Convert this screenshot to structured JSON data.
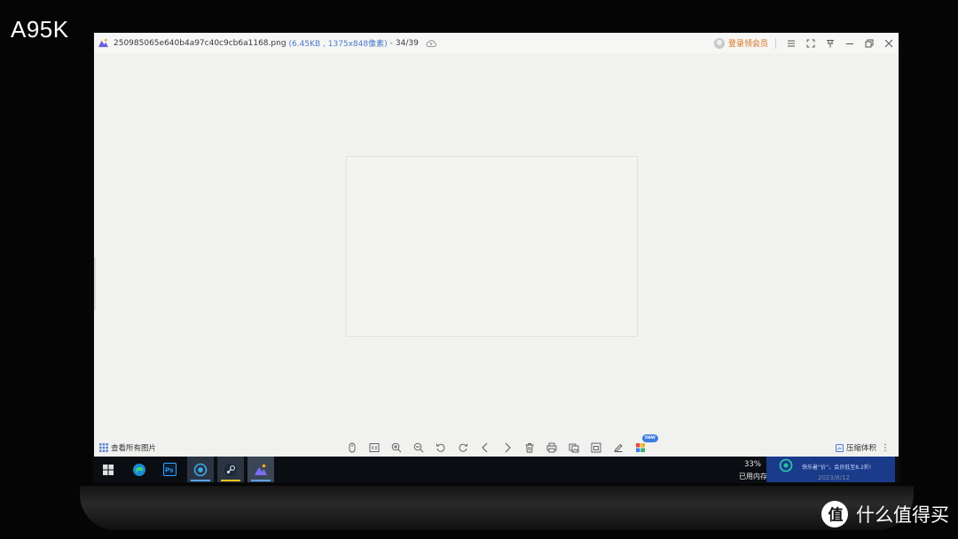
{
  "corner_label": "A95K",
  "window": {
    "file_name": "250985065e640b4a97c40c9cb6a1168.png",
    "meta": "(6.45KB , 1375x848像素)",
    "sep": "-",
    "counter": "34/39",
    "login_label": "登录领会员"
  },
  "bottombar": {
    "view_all_label": "查看所有图片",
    "new_badge": "new",
    "compress_label": "压缩体积"
  },
  "taskbar": {
    "percent": "33%",
    "memory_label": "已用内存"
  },
  "toast": {
    "text": "快乐暑“价”，会员低至8.2折!",
    "date": "2023/8/12"
  },
  "watermark": {
    "text": "什么值得买"
  },
  "colors": {
    "accent_blue": "#4a78c8",
    "login_orange": "#d6701c",
    "taskbar_bg": "#0a0d12",
    "toast_bg": "#1a3a8a"
  }
}
